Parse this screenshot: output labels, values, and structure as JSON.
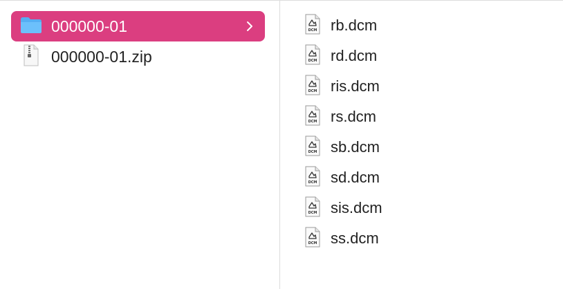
{
  "left_column": {
    "items": [
      {
        "name": "000000-01",
        "kind": "folder",
        "selected": true
      },
      {
        "name": "000000-01.zip",
        "kind": "zip"
      }
    ]
  },
  "right_column": {
    "icon_badge": "DCM",
    "files": [
      {
        "name": "rb.dcm"
      },
      {
        "name": "rd.dcm"
      },
      {
        "name": "ris.dcm"
      },
      {
        "name": "rs.dcm"
      },
      {
        "name": "sb.dcm"
      },
      {
        "name": "sd.dcm"
      },
      {
        "name": "sis.dcm"
      },
      {
        "name": "ss.dcm"
      }
    ]
  },
  "colors": {
    "selection": "#db3e80",
    "folder_icon": "#56aef3",
    "divider": "#dcdcdc",
    "text": "#222222"
  },
  "icons": {
    "folder": "folder-icon",
    "zip": "zip-archive-icon",
    "dcm": "dicom-file-icon",
    "chevron": "chevron-right-icon"
  }
}
